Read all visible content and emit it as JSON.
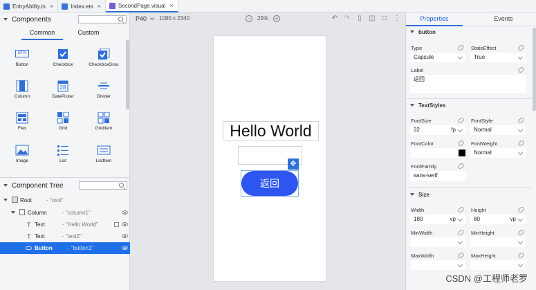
{
  "tabs": [
    {
      "label": "EntryAbility.ts",
      "color": "#3b6fd8"
    },
    {
      "label": "Index.ets",
      "color": "#3b6fd8"
    },
    {
      "label": "SecondPage.visual",
      "color": "#7b5cd6",
      "active": true
    }
  ],
  "left": {
    "components_title": "Components",
    "subtabs": [
      "Common",
      "Custom"
    ],
    "components": [
      {
        "label": "Button",
        "icon": "button-icon"
      },
      {
        "label": "Checkbox",
        "icon": "checkbox-icon"
      },
      {
        "label": "CheckboxGrou",
        "icon": "checkbox-group-icon"
      },
      {
        "label": "Column",
        "icon": "column-icon"
      },
      {
        "label": "DatePicker",
        "icon": "calendar-icon"
      },
      {
        "label": "Divider",
        "icon": "divider-icon"
      },
      {
        "label": "Flex",
        "icon": "flex-icon"
      },
      {
        "label": "Grid",
        "icon": "grid-icon"
      },
      {
        "label": "GridItem",
        "icon": "grid-item-icon"
      },
      {
        "label": "Image",
        "icon": "image-icon"
      },
      {
        "label": "List",
        "icon": "list-icon"
      },
      {
        "label": "ListItem",
        "icon": "list-item-icon"
      }
    ],
    "datepicker_day": "28",
    "button_icon_text": "BTN",
    "tree_title": "Component Tree",
    "tree": [
      {
        "name": "Root",
        "value": "- \"root\""
      },
      {
        "name": "Column",
        "value": "- \"column1\""
      },
      {
        "name": "Text",
        "value": "- \"Hello World\""
      },
      {
        "name": "Text",
        "value": "- \"text2\""
      },
      {
        "name": "Button",
        "value": "- \"button1\"",
        "selected": true
      }
    ]
  },
  "canvas": {
    "device": "P40",
    "resolution": "1080 x 2340",
    "zoom": "25%",
    "hello_text": "Hello World",
    "button_text": "返回"
  },
  "right": {
    "tabs": [
      "Properties",
      "Events"
    ],
    "group_button": "button",
    "type_label": "Type",
    "type_value": "Capsule",
    "state_label": "StateEffect",
    "state_value": "True",
    "label_label": "Label",
    "label_value": "返回",
    "group_textstyles": "TextStyles",
    "fontsize_label": "FontSize",
    "fontsize_value": "32",
    "fontsize_unit": "fp",
    "fontstyle_label": "FontStyle",
    "fontstyle_value": "Normal",
    "fontcolor_label": "FontColor",
    "fontweight_label": "FontWeight",
    "fontweight_value": "Normal",
    "fontfamily_label": "FontFamily",
    "fontfamily_value": "sans-serif",
    "group_size": "Size",
    "width_label": "Width",
    "width_value": "180",
    "width_unit": "vp",
    "height_label": "Height",
    "height_value": "80",
    "height_unit": "vp",
    "minwidth_label": "MinWidth",
    "minheight_label": "MinHeight",
    "maxwidth_label": "MaxWidth",
    "maxheight_label": "MaxHeight"
  },
  "watermark": "CSDN @工程师老罗",
  "colors": {
    "accent": "#2f6fd6",
    "button_fill": "#2d56f0",
    "selected_row": "#1e6fe8",
    "font_color": "#000000"
  }
}
